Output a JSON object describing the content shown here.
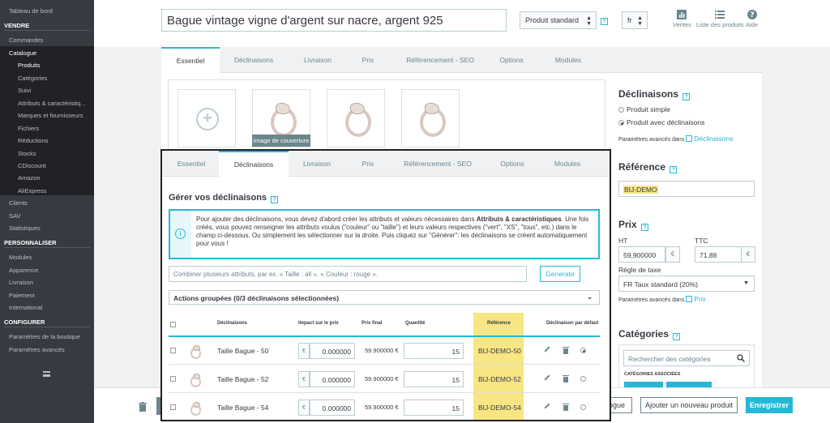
{
  "sidebar": {
    "dashboard": "Tableau de bord",
    "section_sell": "VENDRE",
    "orders": "Commandes",
    "catalog": "Catalogue",
    "catalog_items": [
      "Produits",
      "Catégories",
      "Suivi",
      "Attributs & caractéristiq...",
      "Marques et fournisseurs",
      "Fichiers",
      "Réductions",
      "Stocks",
      "CDiscount",
      "Amazon",
      "AliExpress"
    ],
    "customers": "Clients",
    "sav": "SAV",
    "stats": "Statistiques",
    "section_customize": "PERSONNALISER",
    "modules": "Modules",
    "appearance": "Apparence",
    "shipping": "Livraison",
    "payment": "Paiement",
    "international": "International",
    "section_configure": "CONFIGURER",
    "shop_params": "Paramètres de la boutique",
    "advanced_params": "Paramètres avancés"
  },
  "header": {
    "product_name": "Bague vintage vigne d'argent sur nacre, argent 925",
    "product_type": "Produit standard",
    "language": "fr",
    "help_mark": "?",
    "buttons": {
      "sales": "Ventes",
      "product_list": "Liste des produits",
      "help": "Aide"
    }
  },
  "tabs": [
    "Essentiel",
    "Déclinaisons",
    "Livraison",
    "Prix",
    "Référencement - SEO",
    "Options",
    "Modules"
  ],
  "images": {
    "cover_label": "Image de couverture",
    "add_symbol": "+"
  },
  "right": {
    "combinations_title": "Déclinaisons",
    "simple_product": "Produit simple",
    "product_with_combinations": "Produit avec déclinaisons",
    "advanced_settings_in": "Paramètres avancés dans",
    "combinations_link": "Déclinaisons",
    "reference_title": "Référence",
    "reference_value": "BIJ-DEMO",
    "price_title": "Prix",
    "ht_label": "HT",
    "ttc_label": "TTC",
    "ht_value": "59,900000",
    "ttc_value": "71.88",
    "currency": "€",
    "tax_rule_label": "Règle de taxe",
    "tax_rule_value": "FR Taux standard (20%)",
    "price_link": "Prix",
    "categories_title": "Catégories",
    "category_search_placeholder": "Rechercher des catégories",
    "associated_categories": "CATÉGORIES ASSOCIÉES"
  },
  "footer": {
    "catalog_btn_partial": "logue",
    "add_new_product": "Ajouter un nouveau produit",
    "save": "Enregistrer"
  },
  "overlay": {
    "active_tab": "Déclinaisons",
    "title": "Gérer vos déclinaisons",
    "info_mark": "i",
    "info_pre": "Pour ajouter des déclinaisons, vous devez d'abord créer les attributs et valeurs nécessaires dans ",
    "info_bold": "Attributs & caractéristiques",
    "info_post": ". Une fois créés, vous pouvez renseigner les attributs voulus (\"couleur\" ou \"taille\") et leurs valeurs respectives (\"vert\", \"XS\", \"tous\", etc.) dans le champ ci-dessous. Ou simplement les sélectionner sur la droite. Puis cliquez sur \"Générer\": les déclinaisons se créent automatiquement pour vous !",
    "combine_placeholder": "Combiner plusieurs attributs, par ex. « Taille : all ». « Couleur : rouge ».",
    "generate": "Generate",
    "bulk_actions": "Actions groupées (0/3 déclinaisons sélectionnées)",
    "columns": {
      "combinations": "Déclinaisons",
      "impact": "Impact sur le prix",
      "final_price": "Prix final",
      "quantity": "Quantité",
      "reference": "Référence",
      "default": "Déclinaison par défaut"
    },
    "rows": [
      {
        "name": "Taille Bague - 50",
        "impact": "0.000000",
        "final": "59.900000 €",
        "qty": "15",
        "ref": "BIJ-DEMO-50",
        "default": true
      },
      {
        "name": "Taille Bague - 52",
        "impact": "0.000000",
        "final": "59.900000 €",
        "qty": "15",
        "ref": "BIJ-DEMO-52",
        "default": false
      },
      {
        "name": "Taille Bague - 54",
        "impact": "0.000000",
        "final": "59.900000 €",
        "qty": "15",
        "ref": "BIJ-DEMO-54",
        "default": false
      }
    ]
  }
}
